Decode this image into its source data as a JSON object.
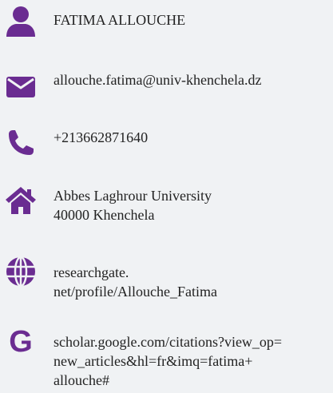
{
  "theme": {
    "accent": "#6a2c91",
    "background": "#f0f2f4",
    "text": "#222222"
  },
  "contact": {
    "name": {
      "icon": "user-icon",
      "text": "FATIMA  ALLOUCHE"
    },
    "email": {
      "icon": "envelope-icon",
      "text": "allouche.fatima@univ-khenchela.dz"
    },
    "phone": {
      "icon": "phone-icon",
      "text": "+213662871640"
    },
    "address": {
      "icon": "home-icon",
      "text": "Abbes Laghrour University\n40000 Khenchela"
    },
    "researchgate": {
      "icon": "globe-icon",
      "text": "researchgate.\nnet/profile/Allouche_Fatima"
    },
    "scholar": {
      "icon": "google-icon",
      "glyph": "G",
      "text": "scholar.google.com/citations?view_op=\nnew_articles&hl=fr&imq=fatima+\nallouche#"
    }
  }
}
